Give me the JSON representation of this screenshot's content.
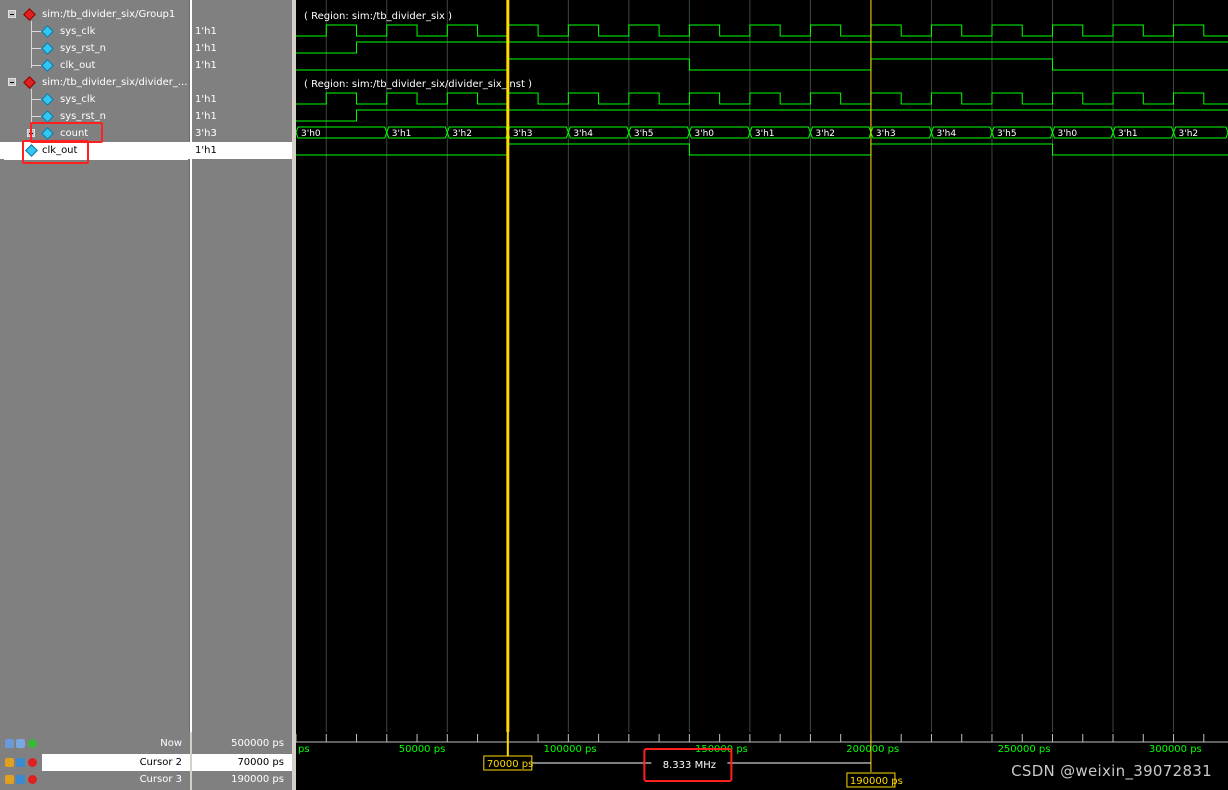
{
  "signals": [
    {
      "name": "sim:/tb_divider_six/Group1",
      "value": "",
      "kind": "group"
    },
    {
      "name": "sys_clk",
      "value": "1'h1",
      "kind": "signal"
    },
    {
      "name": "sys_rst_n",
      "value": "1'h1",
      "kind": "signal"
    },
    {
      "name": "clk_out",
      "value": "1'h1",
      "kind": "signal"
    },
    {
      "name": "sim:/tb_divider_six/divider_...",
      "value": "",
      "kind": "group"
    },
    {
      "name": "sys_clk",
      "value": "1'h1",
      "kind": "signal"
    },
    {
      "name": "sys_rst_n",
      "value": "1'h1",
      "kind": "signal"
    },
    {
      "name": "count",
      "value": "3'h3",
      "kind": "bus"
    },
    {
      "name": "clk_out",
      "value": "1'h1",
      "kind": "signal"
    }
  ],
  "regions": [
    "( Region: sim:/tb_divider_six )",
    "( Region: sim:/tb_divider_six/divider_six_inst )"
  ],
  "count_labels": [
    "3'h0",
    "3'h1",
    "3'h2",
    "3'h3",
    "3'h4",
    "3'h5",
    "3'h0",
    "3'h1",
    "3'h2",
    "3'h3",
    "3'h4",
    "3'h5",
    "3'h0",
    "3'h1",
    "3'h2"
  ],
  "cursors": [
    {
      "label": "Now",
      "value": "500000 ps"
    },
    {
      "label": "Cursor 2",
      "value": "70000 ps"
    },
    {
      "label": "Cursor 3",
      "value": "190000 ps"
    }
  ],
  "cursor_time_ps": [
    70000,
    190000
  ],
  "view_range_ps": [
    0,
    308000
  ],
  "timeline_ticks": [
    "ps",
    "50000 ps",
    "100000 ps",
    "150000 ps",
    "200000 ps",
    "250000 ps",
    "300000 ps"
  ],
  "timeline_tick_ps": [
    0,
    50000,
    100000,
    150000,
    200000,
    250000,
    300000
  ],
  "cursor_2_tag": "70000 ps",
  "cursor_3_tag": "190000 ps",
  "frequency_readout": "8.333 MHz",
  "watermark": "CSDN @weixin_39072831",
  "colors": {
    "wave": "#00ff00",
    "cursor": "#ffd800",
    "grid": "#3a4a3a",
    "highlight": "#ff2020",
    "timeline_text": "#00ff00"
  }
}
